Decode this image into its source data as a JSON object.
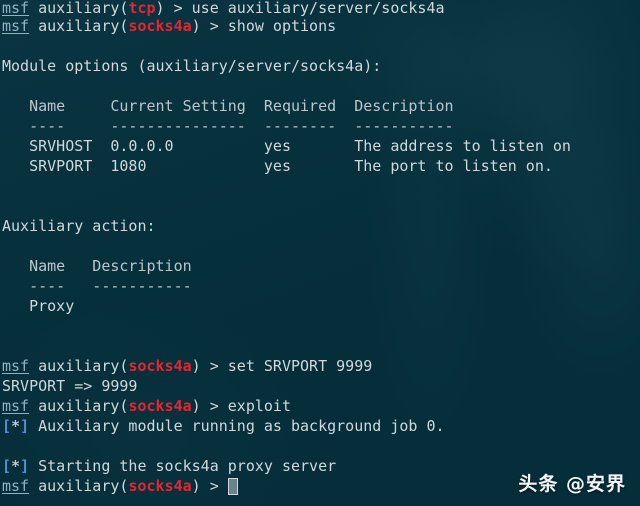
{
  "terminal": {
    "app": "metasploit-framework-console",
    "background_color": "#05303d",
    "foreground_color": "#cfd8dc",
    "prompt_user_color": "#8fb3c4",
    "module_name_color": "#e8252f",
    "status_marker_color": "#4f93d6",
    "prompt_user": "msf",
    "prompt_context": " auxiliary(",
    "prompt_close": ") > ",
    "status_marker_open": "[",
    "status_marker_glyph": "*",
    "status_marker_close": "]"
  },
  "lines": {
    "l01_module": "tcp",
    "l01_cmd": "use auxiliary/server/socks4a",
    "l02_module": "socks4a",
    "l02_cmd": "show options",
    "l04_heading": "Module options (auxiliary/server/socks4a):",
    "l06_header": "   Name     Current Setting  Required  Description",
    "l07_rule": "   ----     ---------------  --------  -----------",
    "l08_row": "   SRVHOST  0.0.0.0          yes       The address to listen on",
    "l09_row": "   SRVPORT  1080             yes       The port to listen on.",
    "l11_heading": "Auxiliary action:",
    "l13_header": "   Name   Description",
    "l14_rule": "   ----   -----------",
    "l15_row": "   Proxy",
    "l17_module": "socks4a",
    "l17_cmd": "set SRVPORT 9999",
    "l18_out": "SRVPORT => 9999",
    "l19_module": "socks4a",
    "l19_cmd": "exploit",
    "l20_out": " Auxiliary module running as background job 0.",
    "l22_out": " Starting the socks4a proxy server",
    "l23_module": "socks4a"
  },
  "table_module_options": {
    "columns": [
      "Name",
      "Current Setting",
      "Required",
      "Description"
    ],
    "rows": [
      [
        "SRVHOST",
        "0.0.0.0",
        "yes",
        "The address to listen on"
      ],
      [
        "SRVPORT",
        "1080",
        "yes",
        "The port to listen on."
      ]
    ]
  },
  "table_auxiliary_action": {
    "columns": [
      "Name",
      "Description"
    ],
    "rows": [
      [
        "Proxy",
        ""
      ]
    ]
  },
  "watermark": {
    "text": "头条 @安界"
  }
}
